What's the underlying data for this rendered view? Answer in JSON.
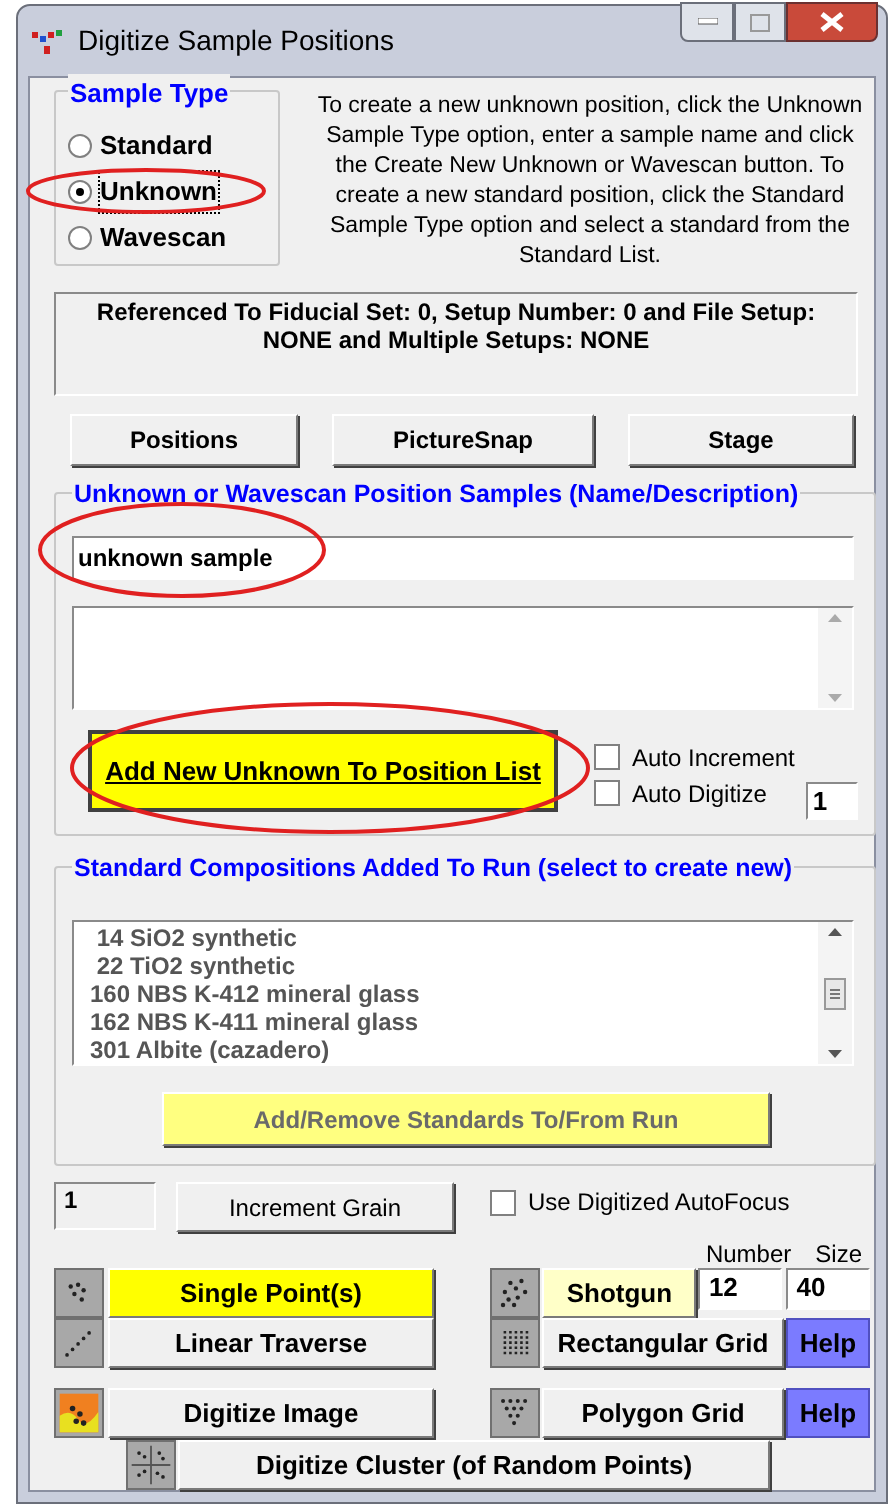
{
  "window": {
    "title": "Digitize Sample Positions"
  },
  "sample_type": {
    "label": "Sample Type",
    "options": [
      {
        "label": "Standard",
        "selected": false
      },
      {
        "label": "Unknown",
        "selected": true
      },
      {
        "label": "Wavescan",
        "selected": false
      }
    ]
  },
  "instructions": "To create a new unknown position, click the Unknown Sample Type option, enter a sample name and click the Create New Unknown or Wavescan button. To create a new standard position, click the Standard Sample Type option and select a standard from the Standard List.",
  "reference_info": "Referenced To Fiducial Set: 0, Setup Number:  0 and File Setup: NONE and Multiple Setups: NONE",
  "top_buttons": [
    "Positions",
    "PictureSnap",
    "Stage"
  ],
  "unknown_group": {
    "label": "Unknown or Wavescan Position Samples (Name/Description)",
    "name_value": "unknown sample",
    "add_button": "Add New Unknown To Position List",
    "options": [
      {
        "label": "Auto Increment",
        "checked": false
      },
      {
        "label": "Auto Digitize",
        "checked": false
      }
    ],
    "digitize_count": "1"
  },
  "standards_group": {
    "label": "Standard Compositions Added To Run (select to create new)",
    "items": [
      " 14 SiO2 synthetic",
      " 22 TiO2 synthetic",
      "160 NBS K-412 mineral glass",
      "162 NBS K-411 mineral glass",
      "301 Albite (cazadero)"
    ],
    "button": "Add/Remove Standards To/From Run"
  },
  "grain": {
    "value": "1",
    "button": "Increment Grain"
  },
  "autofocus": {
    "label": "Use Digitized AutoFocus",
    "checked": false
  },
  "shotgun_params": {
    "number_label": "Number",
    "size_label": "Size",
    "number": "12",
    "size": "40"
  },
  "left_modes": [
    {
      "label": "Single Point(s)",
      "kind": "points",
      "color": "#ffff00"
    },
    {
      "label": "Linear Traverse",
      "kind": "line",
      "color": "#f0f0f0"
    },
    {
      "label": "Digitize Image",
      "kind": "image",
      "color": "#f0f0f0"
    }
  ],
  "right_modes": [
    {
      "label": "Shotgun",
      "kind": "scatter",
      "color": "#ffffc8"
    },
    {
      "label": "Rectangular Grid",
      "kind": "grid",
      "color": "#f0f0f0",
      "help": "Help"
    },
    {
      "label": "Polygon Grid",
      "kind": "triangle",
      "color": "#f0f0f0",
      "help": "Help"
    }
  ],
  "cluster_mode": {
    "label": "Digitize Cluster (of Random Points)",
    "kind": "cluster"
  }
}
